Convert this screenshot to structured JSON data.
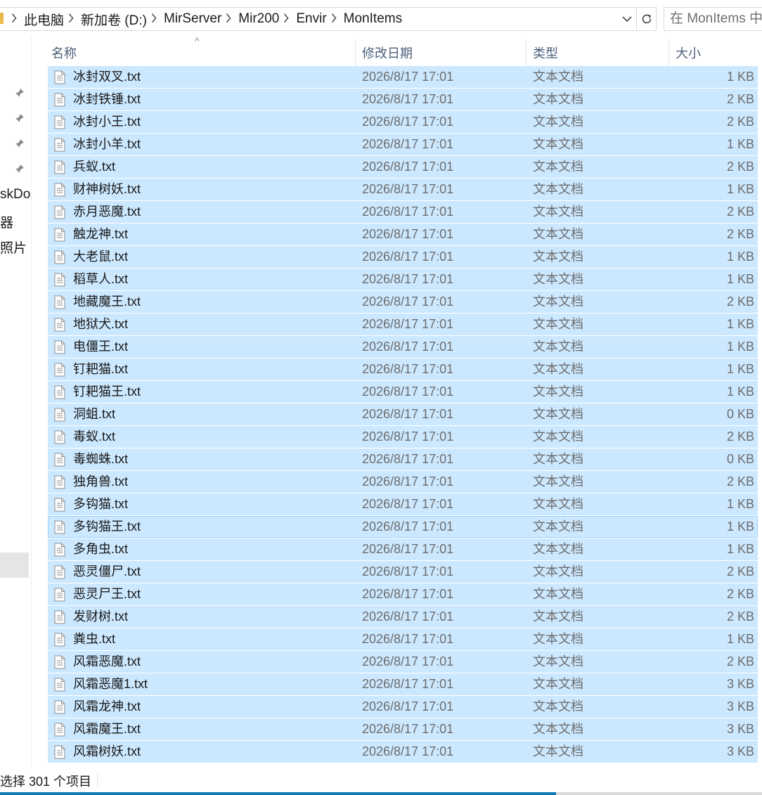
{
  "breadcrumb": [
    "此电脑",
    "新加卷 (D:)",
    "MirServer",
    "Mir200",
    "Envir",
    "MonItems"
  ],
  "search": {
    "placeholder": "在 MonItems 中"
  },
  "nav": {
    "items": [
      "skDo",
      "器",
      "照片"
    ]
  },
  "columns": {
    "name": "名称",
    "date": "修改日期",
    "type": "类型",
    "size": "大小"
  },
  "files": [
    {
      "name": "冰封双叉.txt",
      "date": "2026/8/17 17:01",
      "type": "文本文档",
      "size": "1 KB"
    },
    {
      "name": "冰封铁锤.txt",
      "date": "2026/8/17 17:01",
      "type": "文本文档",
      "size": "2 KB"
    },
    {
      "name": "冰封小王.txt",
      "date": "2026/8/17 17:01",
      "type": "文本文档",
      "size": "2 KB"
    },
    {
      "name": "冰封小羊.txt",
      "date": "2026/8/17 17:01",
      "type": "文本文档",
      "size": "1 KB"
    },
    {
      "name": "兵蚁.txt",
      "date": "2026/8/17 17:01",
      "type": "文本文档",
      "size": "2 KB"
    },
    {
      "name": "财神树妖.txt",
      "date": "2026/8/17 17:01",
      "type": "文本文档",
      "size": "1 KB"
    },
    {
      "name": "赤月恶魔.txt",
      "date": "2026/8/17 17:01",
      "type": "文本文档",
      "size": "2 KB"
    },
    {
      "name": "触龙神.txt",
      "date": "2026/8/17 17:01",
      "type": "文本文档",
      "size": "2 KB"
    },
    {
      "name": "大老鼠.txt",
      "date": "2026/8/17 17:01",
      "type": "文本文档",
      "size": "1 KB"
    },
    {
      "name": "稻草人.txt",
      "date": "2026/8/17 17:01",
      "type": "文本文档",
      "size": "1 KB"
    },
    {
      "name": "地藏魔王.txt",
      "date": "2026/8/17 17:01",
      "type": "文本文档",
      "size": "2 KB"
    },
    {
      "name": "地狱犬.txt",
      "date": "2026/8/17 17:01",
      "type": "文本文档",
      "size": "1 KB"
    },
    {
      "name": "电僵王.txt",
      "date": "2026/8/17 17:01",
      "type": "文本文档",
      "size": "1 KB"
    },
    {
      "name": "钉耙猫.txt",
      "date": "2026/8/17 17:01",
      "type": "文本文档",
      "size": "1 KB"
    },
    {
      "name": "钉耙猫王.txt",
      "date": "2026/8/17 17:01",
      "type": "文本文档",
      "size": "1 KB"
    },
    {
      "name": "洞蛆.txt",
      "date": "2026/8/17 17:01",
      "type": "文本文档",
      "size": "0 KB"
    },
    {
      "name": "毒蚁.txt",
      "date": "2026/8/17 17:01",
      "type": "文本文档",
      "size": "2 KB"
    },
    {
      "name": "毒蜘蛛.txt",
      "date": "2026/8/17 17:01",
      "type": "文本文档",
      "size": "0 KB"
    },
    {
      "name": "独角兽.txt",
      "date": "2026/8/17 17:01",
      "type": "文本文档",
      "size": "2 KB"
    },
    {
      "name": "多钩猫.txt",
      "date": "2026/8/17 17:01",
      "type": "文本文档",
      "size": "1 KB"
    },
    {
      "name": "多钩猫王.txt",
      "date": "2026/8/17 17:01",
      "type": "文本文档",
      "size": "1 KB"
    },
    {
      "name": "多角虫.txt",
      "date": "2026/8/17 17:01",
      "type": "文本文档",
      "size": "1 KB"
    },
    {
      "name": "恶灵僵尸.txt",
      "date": "2026/8/17 17:01",
      "type": "文本文档",
      "size": "2 KB"
    },
    {
      "name": "恶灵尸王.txt",
      "date": "2026/8/17 17:01",
      "type": "文本文档",
      "size": "2 KB"
    },
    {
      "name": "发财树.txt",
      "date": "2026/8/17 17:01",
      "type": "文本文档",
      "size": "2 KB"
    },
    {
      "name": "粪虫.txt",
      "date": "2026/8/17 17:01",
      "type": "文本文档",
      "size": "1 KB"
    },
    {
      "name": "风霜恶魔.txt",
      "date": "2026/8/17 17:01",
      "type": "文本文档",
      "size": "2 KB"
    },
    {
      "name": "风霜恶魔1.txt",
      "date": "2026/8/17 17:01",
      "type": "文本文档",
      "size": "3 KB"
    },
    {
      "name": "风霜龙神.txt",
      "date": "2026/8/17 17:01",
      "type": "文本文档",
      "size": "3 KB"
    },
    {
      "name": "风霜魔王.txt",
      "date": "2026/8/17 17:01",
      "type": "文本文档",
      "size": "3 KB"
    },
    {
      "name": "风霜树妖.txt",
      "date": "2026/8/17 17:01",
      "type": "文本文档",
      "size": "3 KB"
    }
  ],
  "focused_index": 20,
  "status": {
    "text": "选择 301 个项目",
    "progress": 0.73
  },
  "icons": {
    "breadcrumb_sep": "chevron-right-icon",
    "dropdown": "chevron-down-icon",
    "refresh": "refresh-icon",
    "pin": "pin-icon",
    "file": "text-file-icon"
  },
  "colors": {
    "selection": "#cce8ff",
    "focus_border": "#99d1ff",
    "header_text": "#4c607a",
    "progress": "#0f7ab5"
  }
}
